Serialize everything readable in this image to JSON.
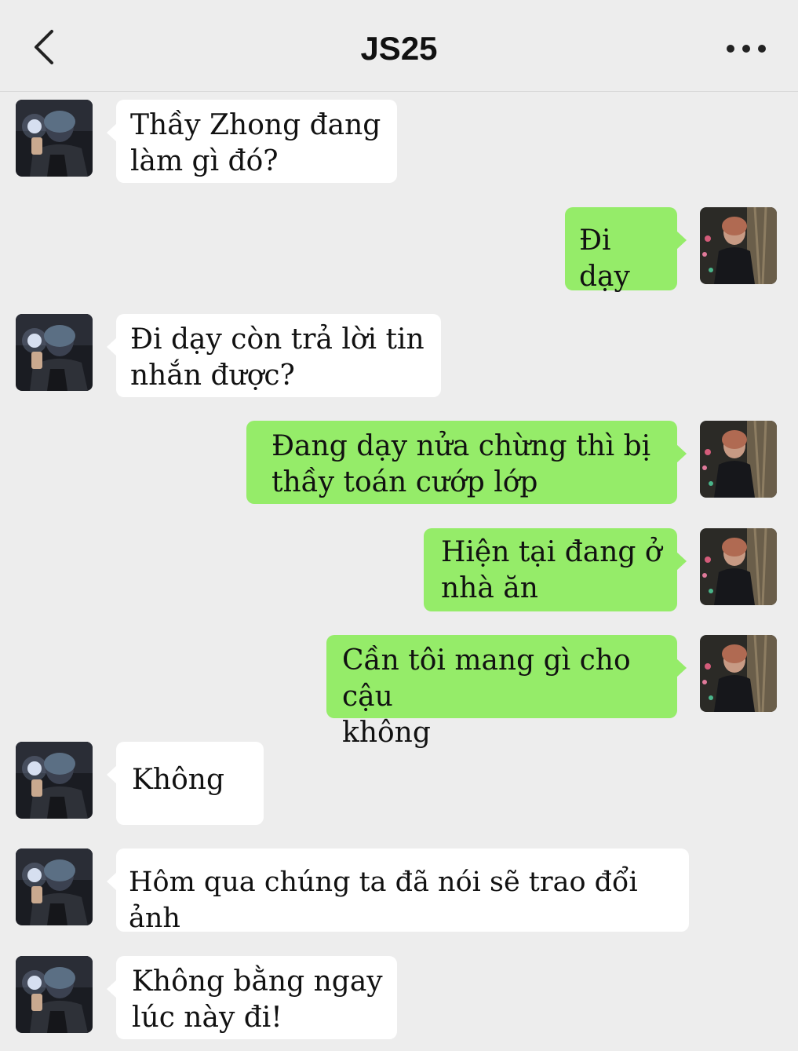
{
  "header": {
    "title": "JS25",
    "back_icon": "chevron-left-icon",
    "more_icon": "more-horizontal-icon"
  },
  "colors": {
    "background": "#ededed",
    "incoming_bubble": "#ffffff",
    "outgoing_bubble": "#95ec69"
  },
  "messages": [
    {
      "side": "in",
      "text": "Thầy Zhong đang\nlàm gì đó?"
    },
    {
      "side": "out",
      "text": "Đi dạy"
    },
    {
      "side": "in",
      "text": "Đi dạy còn trả lời tin\nnhắn được?"
    },
    {
      "side": "out",
      "text": "Đang dạy nửa chừng thì bị\nthầy toán cướp lớp"
    },
    {
      "side": "out",
      "text": "Hiện tại đang ở\nnhà ăn"
    },
    {
      "side": "out",
      "text": "Cần tôi mang gì cho cậu\nkhông"
    },
    {
      "side": "in",
      "text": "Không"
    },
    {
      "side": "in",
      "text": "Hôm qua chúng ta đã nói sẽ trao đổi ảnh"
    },
    {
      "side": "in",
      "text": "Không bằng ngay\nlúc này đi!"
    }
  ]
}
